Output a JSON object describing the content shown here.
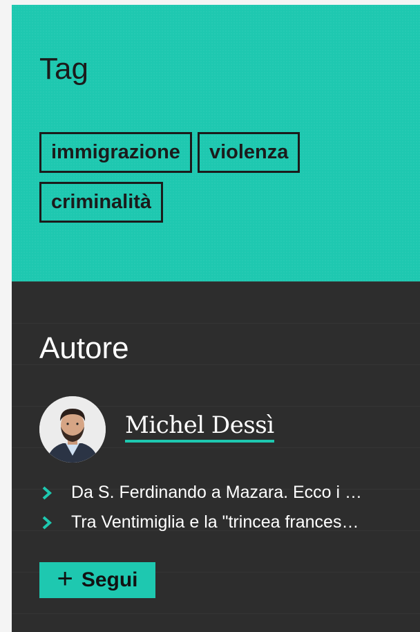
{
  "tags_section": {
    "title": "Tag",
    "tags": [
      "immigrazione",
      "violenza",
      "criminalità"
    ]
  },
  "author_section": {
    "title": "Autore",
    "author_name": "Michel Dessì",
    "articles": [
      "Da S. Ferdinando a Mazara. Ecco i …",
      "Tra Ventimiglia e la \"trincea frances…"
    ],
    "follow_label": "Segui",
    "follow_icon": "plus-icon"
  },
  "colors": {
    "accent": "#1ec8b0",
    "dark_bg": "#2d2d2d",
    "text_dark": "#1b1b1b"
  }
}
